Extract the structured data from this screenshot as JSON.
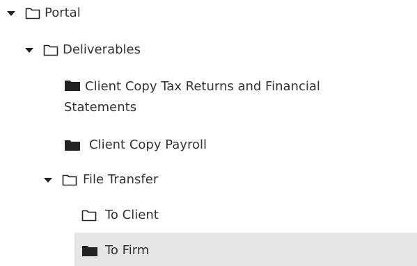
{
  "tree": {
    "portal": {
      "label": "Portal",
      "expanded": true
    },
    "deliverables": {
      "label": "Deliverables",
      "expanded": true
    },
    "client_copy_tax": {
      "label": "Client Copy Tax Returns and Financial Statements"
    },
    "client_copy_payroll": {
      "label": "Client Copy Payroll"
    },
    "file_transfer": {
      "label": "File Transfer",
      "expanded": true
    },
    "to_client": {
      "label": "To Client"
    },
    "to_firm": {
      "label": "To Firm",
      "selected": true
    }
  },
  "colors": {
    "text": "#333333",
    "icon": "#222222",
    "selected_background": "#e6e6e6"
  }
}
